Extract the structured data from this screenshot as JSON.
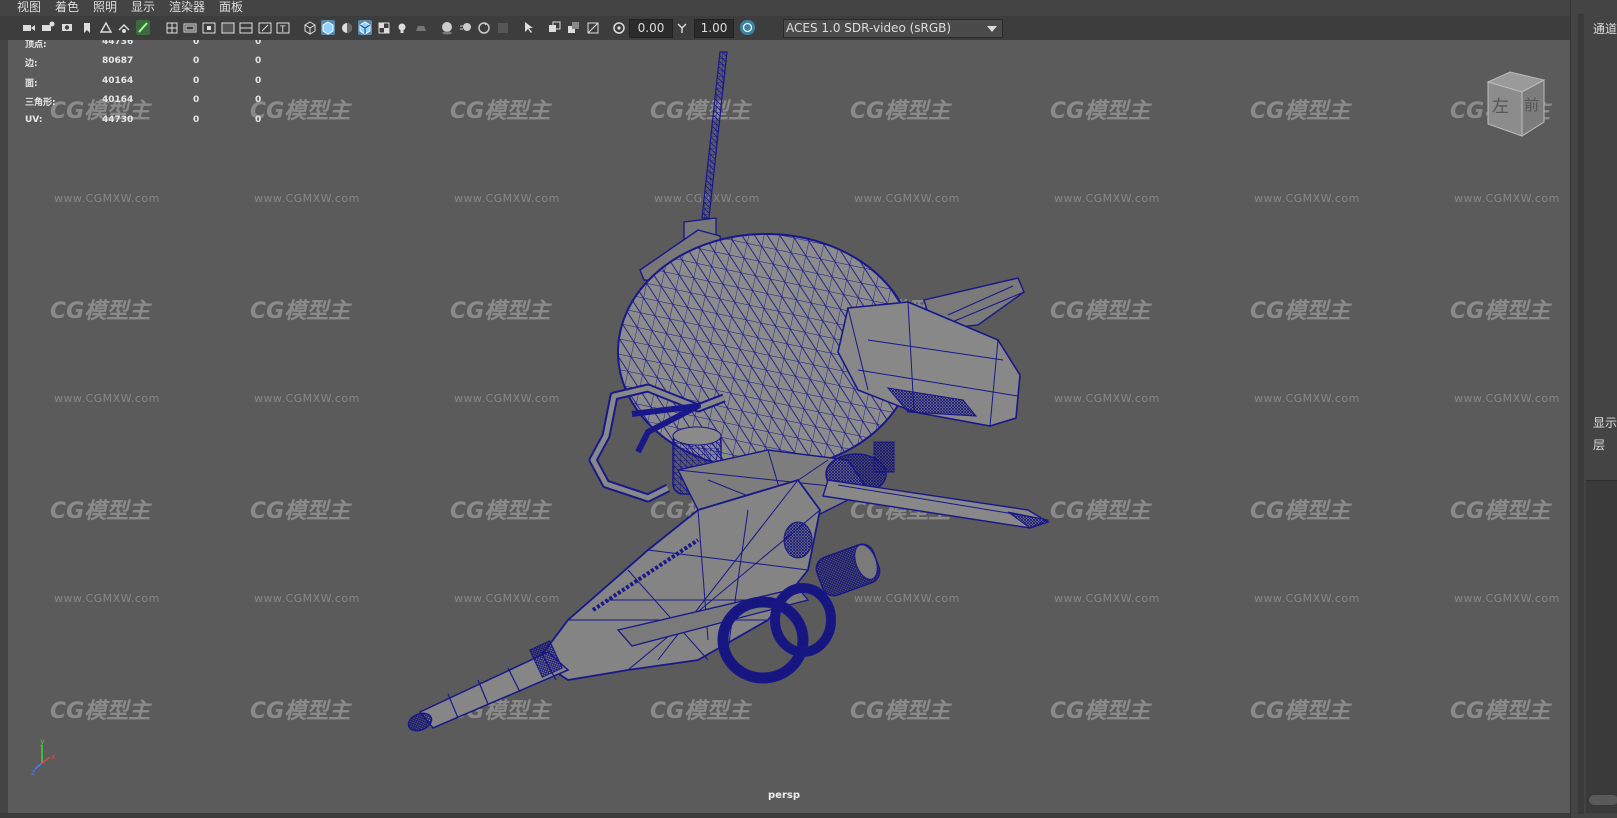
{
  "menu": [
    "视图",
    "着色",
    "照明",
    "显示",
    "渲染器",
    "面板"
  ],
  "toolbar": {
    "icons": [
      "camera-icon",
      "camera-attr-icon",
      "bookmark-icon",
      "image-plane-icon",
      "grid-icon",
      "film-gate-icon",
      "resolution-gate-icon",
      "gate-mask-icon",
      "field-chart-icon",
      "safe-action-icon",
      "safe-title-icon",
      "wireframe-icon",
      "smooth-shade-icon",
      "textured-icon",
      "wireframe-on-shaded-icon",
      "lights-icon",
      "shadows-icon",
      "ssao-icon",
      "motion-blur-icon",
      "antialias-icon",
      "isolate-select-icon",
      "xray-icon",
      "xray-joints-icon",
      "xray-components-icon",
      "exposure-icon",
      "gamma-icon",
      "color-management-icon"
    ],
    "exposure": "0.00",
    "gamma": "1.00",
    "color_space": "ACES 1.0 SDR-video (sRGB)"
  },
  "hud": {
    "rows": [
      {
        "label": "顶点:",
        "values": [
          "44736",
          "0",
          "0"
        ]
      },
      {
        "label": "边:",
        "values": [
          "80687",
          "0",
          "0"
        ]
      },
      {
        "label": "面:",
        "values": [
          "40164",
          "0",
          "0"
        ]
      },
      {
        "label": "三角形:",
        "values": [
          "40164",
          "0",
          "0"
        ]
      },
      {
        "label": "UV:",
        "values": [
          "44730",
          "0",
          "0"
        ]
      }
    ]
  },
  "viewcube": {
    "left": "左",
    "front": "前"
  },
  "camera_label": "persp",
  "watermark": {
    "logo": "CG模型主",
    "url": "www.CGMXW.com"
  },
  "right_panel": {
    "channels": "通道",
    "display": "显示",
    "layers": "层"
  },
  "axis": {
    "y": "y",
    "x": "x",
    "z": "z"
  },
  "colors": {
    "wire": "#18188a",
    "viewport_bg": "#5b5b5b",
    "active_icon": "#5a89b0"
  }
}
